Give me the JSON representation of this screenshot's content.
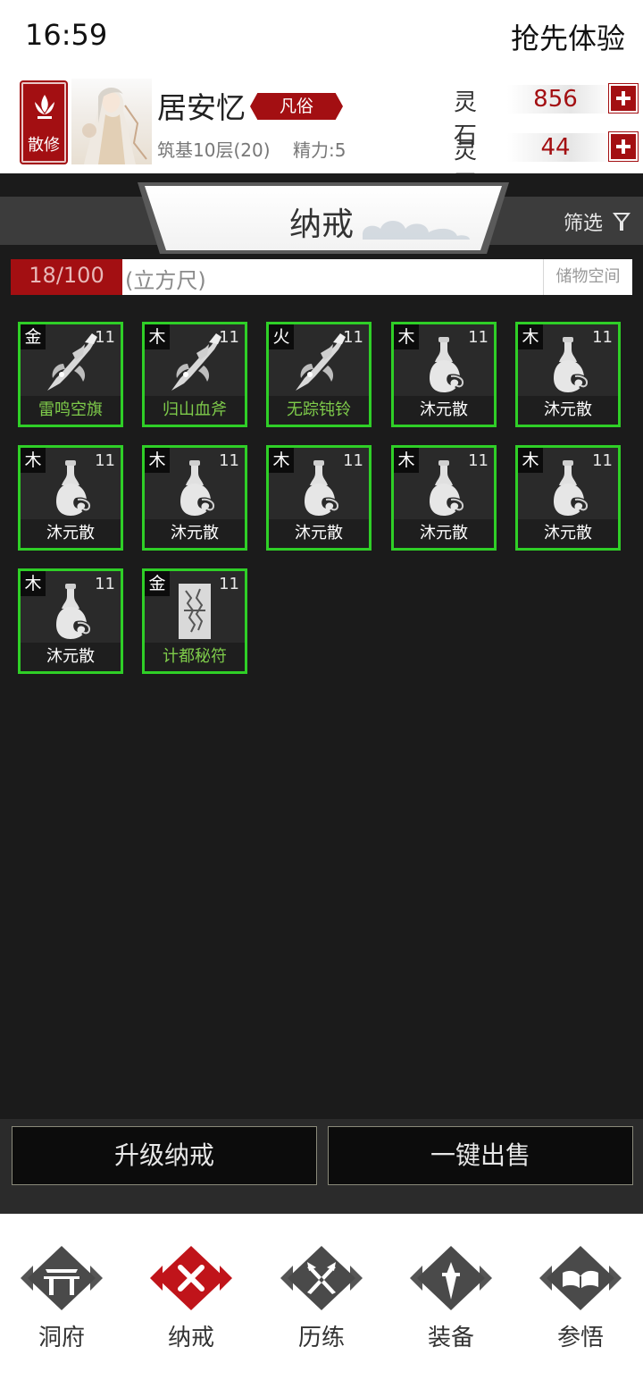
{
  "status": {
    "time": "16:59",
    "action": "抢先体验"
  },
  "player": {
    "sect": "散修",
    "name": "居安忆",
    "rank": "凡俗",
    "realm": "筑基10层(20)",
    "energy": "精力:5"
  },
  "resources": [
    {
      "label": "灵石",
      "value": "856"
    },
    {
      "label": "灵玉",
      "value": "44"
    }
  ],
  "titlebar": {
    "title": "纳戒",
    "filter": "筛选"
  },
  "capacity": {
    "value": "18/100",
    "used_fraction": 0.18,
    "unit": "(立方尺)",
    "storage": "储物空间"
  },
  "items": [
    {
      "element": "金",
      "level": "11",
      "name": "雷鸣空旗",
      "icon": "weapon-icon",
      "name_color": "green"
    },
    {
      "element": "木",
      "level": "11",
      "name": "归山血斧",
      "icon": "weapon-icon",
      "name_color": "green"
    },
    {
      "element": "火",
      "level": "11",
      "name": "无踪钝铃",
      "icon": "weapon-icon",
      "name_color": "green"
    },
    {
      "element": "木",
      "level": "11",
      "name": "沐元散",
      "icon": "potion-gourd-icon",
      "name_color": "white"
    },
    {
      "element": "木",
      "level": "11",
      "name": "沐元散",
      "icon": "potion-gourd-icon",
      "name_color": "white"
    },
    {
      "element": "木",
      "level": "11",
      "name": "沐元散",
      "icon": "potion-gourd-icon",
      "name_color": "white"
    },
    {
      "element": "木",
      "level": "11",
      "name": "沐元散",
      "icon": "potion-gourd-icon",
      "name_color": "white"
    },
    {
      "element": "木",
      "level": "11",
      "name": "沐元散",
      "icon": "potion-gourd-icon",
      "name_color": "white"
    },
    {
      "element": "木",
      "level": "11",
      "name": "沐元散",
      "icon": "potion-gourd-icon",
      "name_color": "white"
    },
    {
      "element": "木",
      "level": "11",
      "name": "沐元散",
      "icon": "potion-gourd-icon",
      "name_color": "white"
    },
    {
      "element": "木",
      "level": "11",
      "name": "沐元散",
      "icon": "potion-gourd-icon",
      "name_color": "white"
    },
    {
      "element": "金",
      "level": "11",
      "name": "计都秘符",
      "icon": "talisman-icon",
      "name_color": "green"
    }
  ],
  "actions": {
    "upgrade": "升级纳戒",
    "sell_all": "一键出售"
  },
  "nav": [
    {
      "label": "洞府",
      "icon": "gate-icon",
      "active": false
    },
    {
      "label": "纳戒",
      "icon": "close-icon",
      "active": true
    },
    {
      "label": "历练",
      "icon": "crossed-swords-icon",
      "active": false
    },
    {
      "label": "装备",
      "icon": "dagger-icon",
      "active": false
    },
    {
      "label": "参悟",
      "icon": "open-book-icon",
      "active": false
    }
  ],
  "colors": {
    "accent_red": "#a30f12",
    "item_border": "#2fcf27",
    "item_name_green": "#7ecb4a",
    "background_dark": "#1b1b1b"
  }
}
